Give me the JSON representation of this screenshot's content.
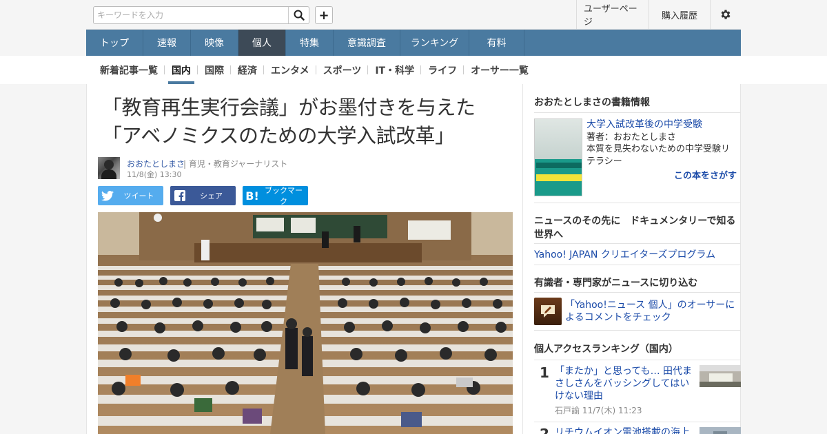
{
  "header": {
    "search_placeholder": "キーワードを入力",
    "search_value": "",
    "user_page": "ユーザーページ",
    "purchase_history": "購入履歴"
  },
  "main_nav": [
    {
      "label": "トップ",
      "active": false
    },
    {
      "label": "速報",
      "active": false
    },
    {
      "label": "映像",
      "active": false
    },
    {
      "label": "個人",
      "active": true
    },
    {
      "label": "特集",
      "active": false
    },
    {
      "label": "意識調査",
      "active": false
    },
    {
      "label": "ランキング",
      "active": false
    },
    {
      "label": "有料",
      "active": false
    }
  ],
  "sub_nav": [
    {
      "label": "新着記事一覧",
      "active": false
    },
    {
      "label": "国内",
      "active": true
    },
    {
      "label": "国際",
      "active": false
    },
    {
      "label": "経済",
      "active": false
    },
    {
      "label": "エンタメ",
      "active": false
    },
    {
      "label": "スポーツ",
      "active": false
    },
    {
      "label": "IT・科学",
      "active": false
    },
    {
      "label": "ライフ",
      "active": false
    },
    {
      "label": "オーサー一覧",
      "active": false
    }
  ],
  "article": {
    "title_line1": "「教育再生実行会議」がお墨付きを与えた",
    "title_line2": "「アベノミクスのための大学入試改革」",
    "author": "おおたとしまさ",
    "author_role": "| 育児・教育ジャーナリスト",
    "date": "11/8(金) 13:30",
    "share": {
      "tweet": "ツイート",
      "share": "シェア",
      "bookmark": "ブックマーク"
    }
  },
  "sidebar": {
    "book_section_title": "おおたとしまさの書籍情報",
    "book": {
      "title": "大学入試改革後の中学受験",
      "author": "著者：おおたとしまさ",
      "description": "本質を見失わないための中学受験リテラシー",
      "find_label": "この本をさがす"
    },
    "doc_section_title": "ニュースのその先に　ドキュメンタリーで知る世界へ",
    "doc_link": "Yahoo! JAPAN クリエイターズプログラム",
    "expert_section_title": "有識者・専門家がニュースに切り込む",
    "expert_link": "「Yahoo!ニュース 個人」のオーサーによるコメントをチェック",
    "ranking_section_title": "個人アクセスランキング（国内）",
    "ranking": [
      {
        "rank": "1",
        "title": "「またか」と思っても… 田代まさしさんをバッシングしてはいけない理由",
        "meta": "石戸諭 11/7(木) 11:23"
      },
      {
        "rank": "2",
        "title": "リチウムイオン電池搭載の海上",
        "meta": ""
      }
    ]
  },
  "colors": {
    "nav_bg": "#4a7aa0",
    "nav_active": "#3d4a57",
    "link": "#1a4aa8",
    "twitter": "#55acee",
    "facebook": "#3b5998",
    "hatena": "#008fde"
  }
}
